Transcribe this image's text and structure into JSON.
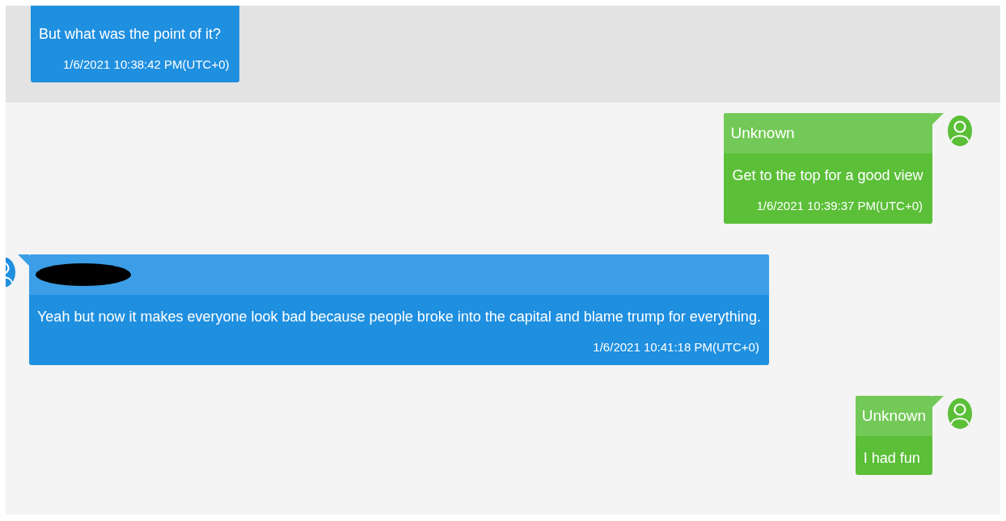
{
  "messages": [
    {
      "kind": "incoming",
      "highlighted": true,
      "text": "But what was the point of it?",
      "timestamp": "1/6/2021 10:38:42 PM(UTC+0)"
    },
    {
      "kind": "outgoing",
      "highlighted": false,
      "sender": "Unknown",
      "text": "Get to the top for a good view",
      "timestamp": "1/6/2021 10:39:37 PM(UTC+0)"
    },
    {
      "kind": "incoming",
      "highlighted": false,
      "sender_redacted": true,
      "text": "Yeah but now it makes everyone look bad because people broke into the capital and blame trump for everything.",
      "timestamp": "1/6/2021 10:41:18 PM(UTC+0)"
    },
    {
      "kind": "outgoing",
      "highlighted": false,
      "sender": "Unknown",
      "text": "I had fun"
    }
  ]
}
